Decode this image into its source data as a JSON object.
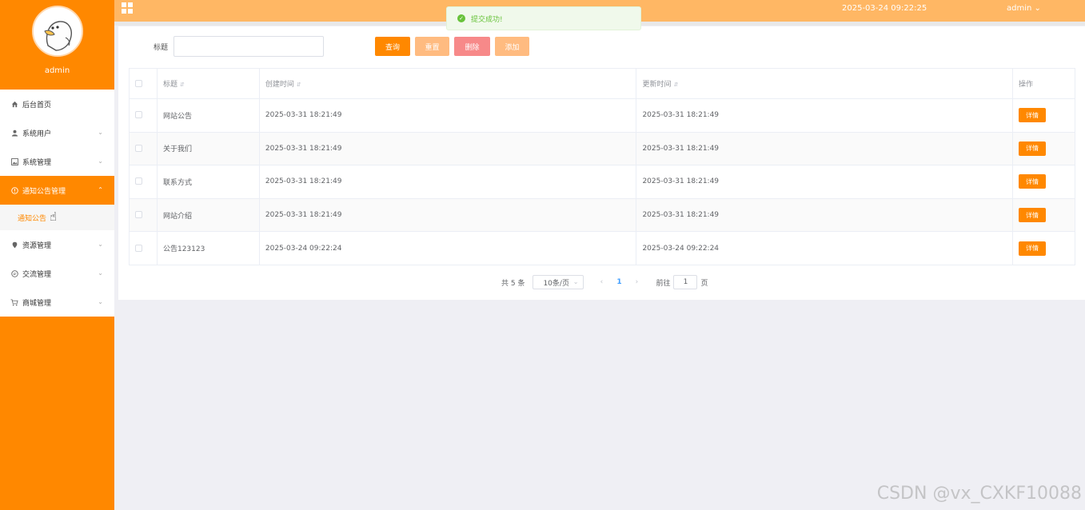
{
  "sidebar": {
    "user": "admin",
    "items": [
      {
        "label": "后台首页",
        "icon": "home-icon"
      },
      {
        "label": "系统用户",
        "icon": "user-icon",
        "expandable": true
      },
      {
        "label": "系统管理",
        "icon": "image-icon",
        "expandable": true
      },
      {
        "label": "通知公告管理",
        "icon": "info-icon",
        "expandable": true,
        "active": true
      },
      {
        "label": "资源管理",
        "icon": "location-icon",
        "expandable": true
      },
      {
        "label": "交流管理",
        "icon": "chat-icon",
        "expandable": true
      },
      {
        "label": "商城管理",
        "icon": "cart-icon",
        "expandable": true
      }
    ],
    "submenu_active": "通知公告"
  },
  "topbar": {
    "datetime": "2025-03-24 09:22:25",
    "user_menu": "admin"
  },
  "toast": {
    "message": "提交成功!"
  },
  "search": {
    "label": "标题",
    "value": ""
  },
  "toolbar": {
    "query_label": "查询",
    "reset_label": "重置",
    "delete_label": "删除",
    "add_label": "添加"
  },
  "table": {
    "headers": [
      "标题",
      "创建时间",
      "更新时间",
      "操作"
    ],
    "rows": [
      {
        "title": "网站公告",
        "created": "2025-03-31 18:21:49",
        "updated": "2025-03-31 18:21:49"
      },
      {
        "title": "关于我们",
        "created": "2025-03-31 18:21:49",
        "updated": "2025-03-31 18:21:49"
      },
      {
        "title": "联系方式",
        "created": "2025-03-31 18:21:49",
        "updated": "2025-03-31 18:21:49"
      },
      {
        "title": "网站介绍",
        "created": "2025-03-31 18:21:49",
        "updated": "2025-03-31 18:21:49"
      },
      {
        "title": "公告123123",
        "created": "2025-03-24 09:22:24",
        "updated": "2025-03-24 09:22:24"
      }
    ],
    "action_label": "详情"
  },
  "pagination": {
    "total": "共 5 条",
    "page_size": "10条/页",
    "current_page": "1",
    "goto_prefix": "前往",
    "goto_value": "1",
    "goto_suffix": "页"
  },
  "watermark": "CSDN @vx_CXKF10088",
  "colors": {
    "accent": "#ff8800",
    "topbar": "#ffb764",
    "danger": "#f78989",
    "success": "#67c23a"
  }
}
